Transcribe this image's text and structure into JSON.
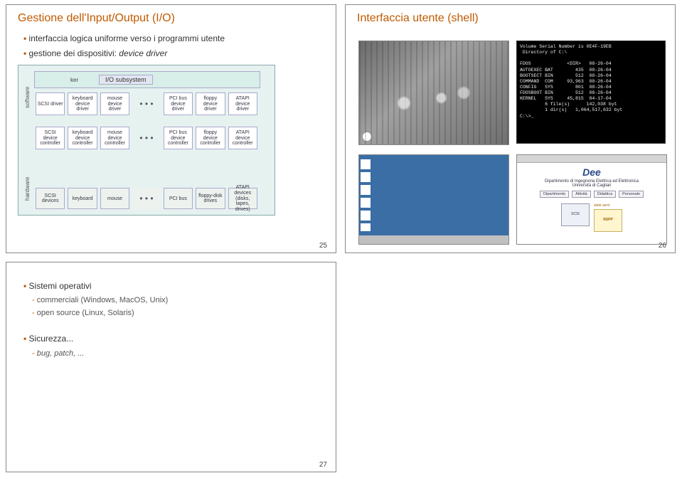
{
  "slide25": {
    "title": "Gestione dell'Input/Output (I/O)",
    "bullet1": "interfaccia logica uniforme verso i programmi utente",
    "bullet2_pre": "gestione dei dispositivi: ",
    "bullet2_em": "device driver",
    "pagenum": "25",
    "diagram": {
      "vlabel_sw": "software",
      "vlabel_hw": "hardware",
      "ker": "ker",
      "iosub": "I/O subsystem",
      "row_drivers": [
        "SCSI driver",
        "keyboard device driver",
        "mouse device driver",
        "• • •",
        "PCI bus device driver",
        "floppy device driver",
        "ATAPI device driver"
      ],
      "row_controllers": [
        "SCSI device controller",
        "keyboard device controller",
        "mouse device controller",
        "• • •",
        "PCI bus device controller",
        "floppy device controller",
        "ATAPI device controller"
      ],
      "row_devices": [
        "SCSI devices",
        "keyboard",
        "mouse",
        "• • •",
        "PCI bus",
        "floppy-disk drives",
        "ATAPI devices (disks, tapes, drives)"
      ]
    }
  },
  "slide26": {
    "title": "Interfaccia utente (shell)",
    "pagenum": "26",
    "dos": "Volume Serial Number is 0E4F-19EB\n Directory of C:\\\n\nFDOS             <DIR>   08-26-04\nAUTOEXEC BAT        435  08-26-04\nBOOTSECT BIN        512  08-26-04\nCOMMAND  COM     93,963  08-26-04\nCONFIG   SYS        801  08-26-04\nFDOSBOOT BIN        512  08-26-04\nKERNEL   SYS     45,815  04-17-04\n         6 file(s)      142,038 byt\n         1 dir(s)   1,064,517,632 byt\nC:\\>_",
    "web": {
      "logo": "Dee",
      "subtitle1": "Dipartimento di Ingegneria Elettrica ed Elettronica",
      "subtitle2": "Università di Cagliari",
      "links": [
        "Dipartimento",
        "Attività",
        "Didattica",
        "Personale"
      ],
      "box_left": "SCSI",
      "box_right_top": "siete servi",
      "box_right": "RSPP"
    }
  },
  "slide27": {
    "bullet1": "Sistemi operativi",
    "sub1": "commerciali (Windows, MacOS, Unix)",
    "sub2": "open source (Linux, Solaris)",
    "bullet2": "Sicurezza...",
    "sub3": "bug, patch, ...",
    "pagenum": "27"
  }
}
